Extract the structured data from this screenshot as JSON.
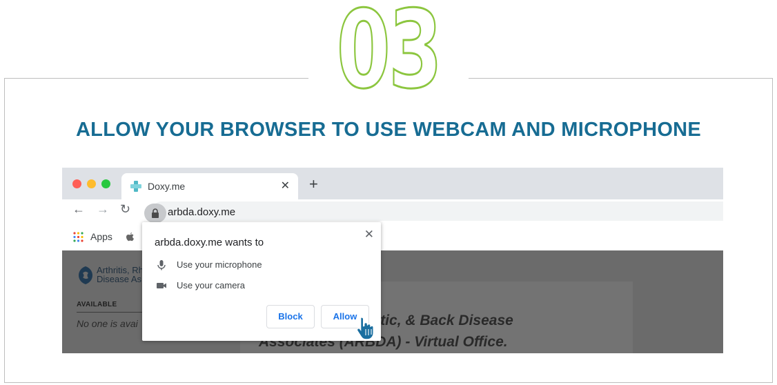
{
  "step": {
    "number": "03"
  },
  "heading": "ALLOW YOUR BROWSER TO USE WEBCAM AND MICROPHONE",
  "browser": {
    "tab": {
      "title": "Doxy.me"
    },
    "url": "arbda.doxy.me",
    "bookmarks": {
      "apps_label": "Apps"
    }
  },
  "page": {
    "logo_line1": "Arthritis, Rh",
    "logo_line2": "Disease As",
    "available_label": "AVAILABLE",
    "no_one_text": "No one is avai",
    "office_title_line1": "Arthritis, Rheumatic, & Back Disease",
    "office_title_line2": "Associates (ARBDA) - Virtual Office."
  },
  "popup": {
    "title": "arbda.doxy.me wants to",
    "microphone_text": "Use your microphone",
    "camera_text": "Use your camera",
    "block_label": "Block",
    "allow_label": "Allow"
  },
  "colors": {
    "step_outline": "#8cc63f",
    "heading": "#176c93",
    "button_text": "#1a73e8",
    "traffic_red": "#ff5f57",
    "traffic_yellow": "#febc2e",
    "traffic_green": "#28c840",
    "favicon": "#4fb9c6"
  },
  "icons": [
    "close-icon",
    "plus-icon",
    "back-icon",
    "forward-icon",
    "reload-icon",
    "lock-icon",
    "apps-icon",
    "apple-icon",
    "microphone-icon",
    "camera-icon",
    "hand-cursor-icon"
  ]
}
